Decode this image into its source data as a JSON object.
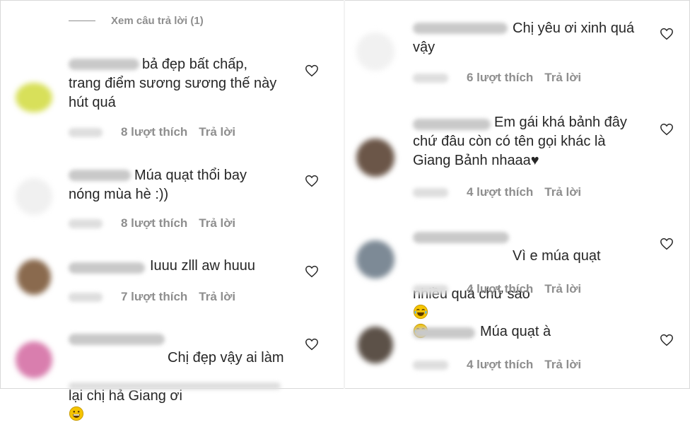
{
  "view_replies": "Xem câu trả lời (1)",
  "left": [
    {
      "text": "bả đẹp bất chấp,\ntrang điểm sương sương thế này\nhút quá",
      "likes": "8 lượt thích",
      "reply": "Trả lời"
    },
    {
      "text": "Múa quạt thổi bay\nnóng mùa hè :))",
      "likes": "8 lượt thích",
      "reply": "Trả lời"
    },
    {
      "text": "Iuuu zlll aw huuu",
      "likes": "7 lượt thích",
      "reply": "Trả lời"
    },
    {
      "text_lines": [
        "Chị đẹp vậy ai làm",
        "lại chị hả Giang ơi"
      ],
      "likes": "",
      "reply": ""
    }
  ],
  "right": [
    {
      "text": "Chị yêu ơi xinh quá\nvậy",
      "likes": "6 lượt thích",
      "reply": "Trả lời"
    },
    {
      "text": "Em gái khá bảnh đây\nchứ đâu còn có tên gọi khác là\nGiang Bảnh nhaaa♥",
      "likes": "4 lượt thích",
      "reply": "Trả lời"
    },
    {
      "text_lines": [
        "Vì e múa quạt",
        "nhiều quá chứ sao"
      ],
      "likes": "4 lượt thích",
      "reply": "Trả lời"
    },
    {
      "text": "Múa quạt à",
      "likes": "4 lượt thích",
      "reply": "Trả lời"
    }
  ],
  "icons": {
    "heart": "heart-outline-icon",
    "emoji": "grinning-face-emoji",
    "emoji_laugh": "tears-of-joy-emoji"
  }
}
